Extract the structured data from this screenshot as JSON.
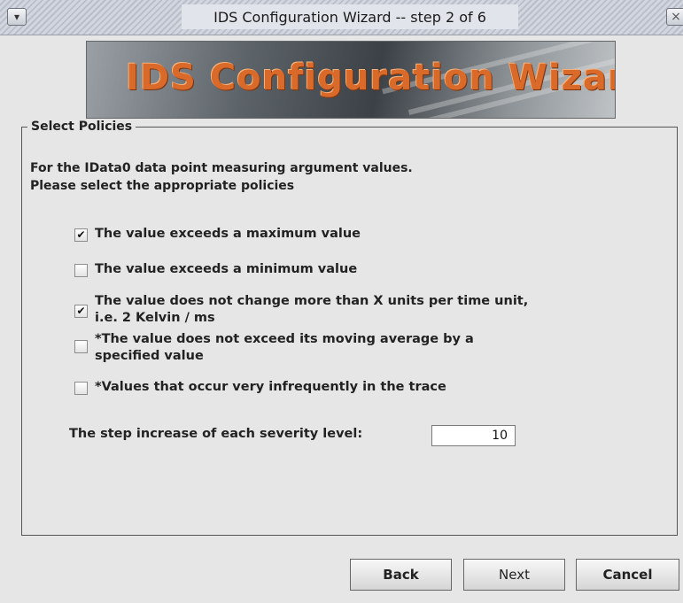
{
  "window": {
    "title": "IDS Configuration Wizard -- step 2 of 6",
    "menu_glyph": "▾",
    "close_glyph": "×"
  },
  "banner": {
    "logo_text": "IDS Configuration Wizard"
  },
  "group": {
    "legend": "Select Policies",
    "intro_line1": "For the IData0 data point measuring argument values.",
    "intro_line2": "Please select the appropriate policies"
  },
  "policies": [
    {
      "label": "The value exceeds a maximum value",
      "checked": true
    },
    {
      "label": "The value exceeds a minimum value",
      "checked": false
    },
    {
      "label": "The value does not change more than X units per time unit, i.e. 2 Kelvin / ms",
      "checked": true
    },
    {
      "label": "*The value does not exceed its moving average by a specified value",
      "checked": false
    },
    {
      "label": "*Values that occur very infrequently in the trace",
      "checked": false
    }
  ],
  "severity": {
    "label": "The step increase of each severity level:",
    "value": "10"
  },
  "buttons": {
    "back": "Back",
    "next": "Next",
    "cancel": "Cancel"
  }
}
